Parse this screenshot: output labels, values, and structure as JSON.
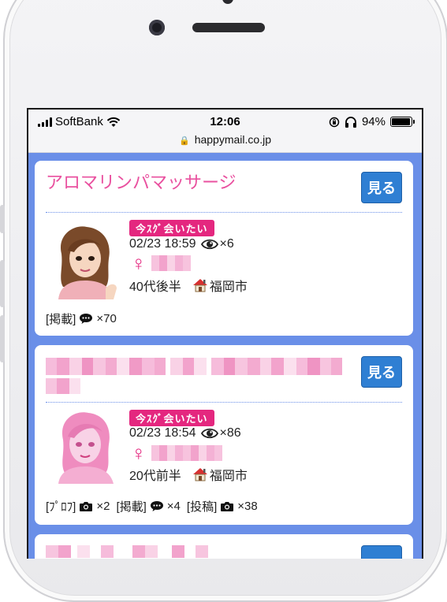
{
  "status": {
    "carrier": "SoftBank",
    "time": "12:06",
    "battery": "94%",
    "battery_level": 0.94
  },
  "url": {
    "domain": "happymail.co.jp"
  },
  "posts": [
    {
      "title": "アロマリンパマッサージ",
      "view_label": "見る",
      "badge": "今ｽｸﾞ会いたい",
      "datetime": "02/23 18:59",
      "views": "×6",
      "gender_symbol": "♀",
      "age": "40代後半",
      "location": "福岡市",
      "stats": [
        {
          "label": "[掲載]",
          "icon": "speech-bubble-icon",
          "count": "×70"
        }
      ]
    },
    {
      "title": "",
      "view_label": "見る",
      "badge": "今ｽｸﾞ会いたい",
      "datetime": "02/23 18:54",
      "views": "×86",
      "gender_symbol": "♀",
      "age": "20代前半",
      "location": "福岡市",
      "stats": [
        {
          "label": "[ﾌﾟﾛﾌ]",
          "icon": "camera-icon",
          "count": "×2"
        },
        {
          "label": "[掲載]",
          "icon": "speech-bubble-icon",
          "count": "×4"
        },
        {
          "label": "[投稿]",
          "icon": "camera-icon",
          "count": "×38"
        }
      ]
    }
  ],
  "colors": {
    "accent_pink": "#e9509f",
    "button_blue": "#2f7fd3",
    "background_blue": "#6a8fe8",
    "badge_pink": "#e4277f"
  }
}
